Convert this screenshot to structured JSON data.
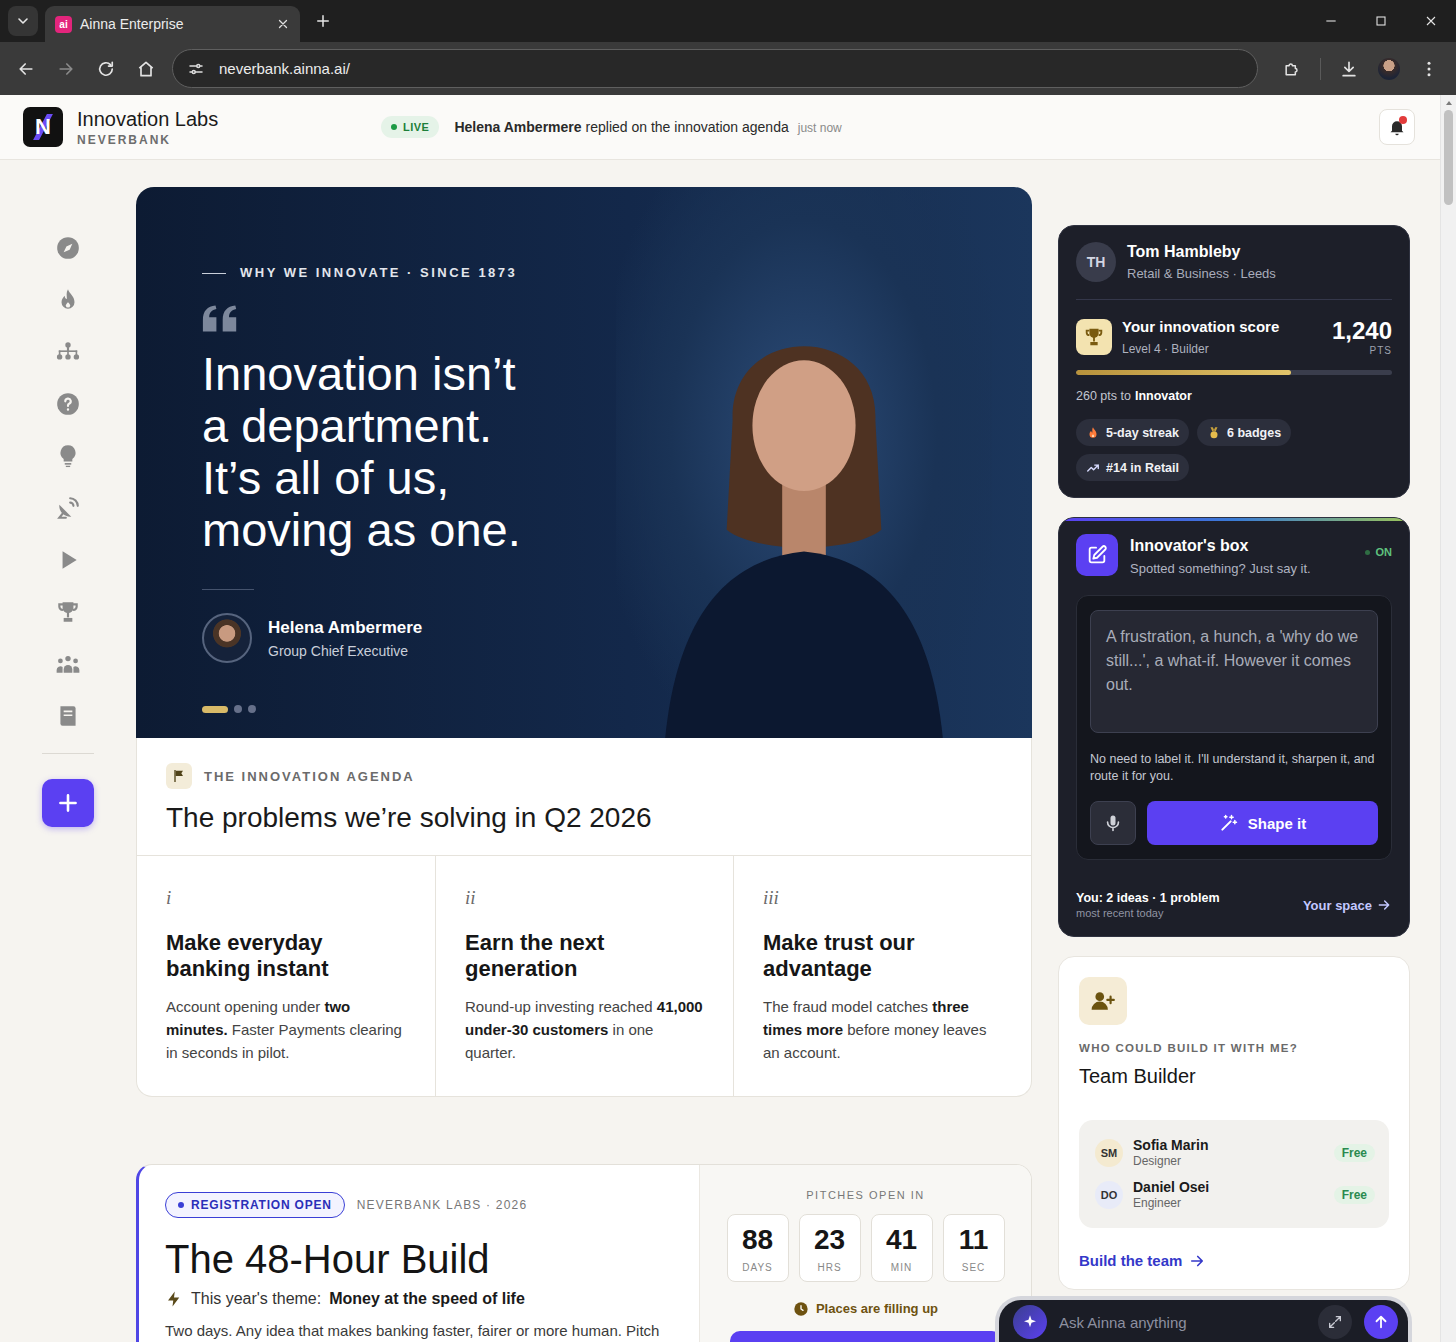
{
  "browser": {
    "tab": {
      "favicon": "ai",
      "title": "Ainna Enterprise",
      "selected": true
    },
    "navigation": {
      "back_enabled": true,
      "forward_enabled": false
    },
    "address": "neverbank.ainna.ai/"
  },
  "header": {
    "logo": "N",
    "title": "Innovation Labs",
    "subtitle": "NEVERBANK",
    "live": "LIVE",
    "activity": {
      "name": "Helena Ambermere",
      "text": "replied on the innovation agenda",
      "time": "just now"
    },
    "notifications_unread": true
  },
  "sidebar": {
    "items": [
      {
        "selected": false
      },
      {
        "selected": false
      },
      {
        "selected": false
      },
      {
        "selected": false
      },
      {
        "selected": false
      },
      {
        "selected": false
      },
      {
        "selected": false
      },
      {
        "selected": false
      },
      {
        "selected": false
      },
      {
        "selected": false
      }
    ]
  },
  "hero": {
    "eyebrow": "WHY WE INNOVATE · SINCE 1873",
    "quote": [
      "Innovation isn’t",
      "a department.",
      "It’s all of us,",
      "moving as one."
    ],
    "author": {
      "name": "Helena Ambermere",
      "role": "Group Chief Executive"
    },
    "slides": [
      {
        "selected": true
      },
      {
        "selected": false
      },
      {
        "selected": false
      }
    ]
  },
  "agenda": {
    "eyebrow": "THE INNOVATION AGENDA",
    "title": "The problems we’re solving in Q2 2026",
    "items": [
      {
        "numeral": "i",
        "title_lines": [
          "Make everyday",
          "banking instant"
        ],
        "body": [
          {
            "text": "Account opening under ",
            "bold": false
          },
          {
            "text": "two minutes.",
            "bold": true
          },
          {
            "text": " Faster Payments clearing in seconds in pilot.",
            "bold": false
          }
        ]
      },
      {
        "numeral": "ii",
        "title_lines": [
          "Earn the next",
          "generation"
        ],
        "body": [
          {
            "text": "Round-up investing reached ",
            "bold": false
          },
          {
            "text": "41,000 under-30 customers",
            "bold": true
          },
          {
            "text": " in one quarter.",
            "bold": false
          }
        ]
      },
      {
        "numeral": "iii",
        "title_lines": [
          "Make trust our",
          "advantage"
        ],
        "body": [
          {
            "text": "The fraud model catches ",
            "bold": false
          },
          {
            "text": "three times more",
            "bold": true
          },
          {
            "text": " before money leaves an account.",
            "bold": false
          }
        ]
      }
    ]
  },
  "build": {
    "badge": "REGISTRATION OPEN",
    "org": "NEVERBANK LABS · 2026",
    "title": "The 48-Hour Build",
    "theme_label": "This year's theme:",
    "theme": "Money at the speed of life",
    "description": "Two days. Any idea that makes banking faster, fairer or more human. Pitch",
    "countdown": {
      "label": "PITCHES OPEN IN",
      "units": [
        {
          "value": "88",
          "unit": "DAYS"
        },
        {
          "value": "23",
          "unit": "HRS"
        },
        {
          "value": "41",
          "unit": "MIN"
        },
        {
          "value": "11",
          "unit": "SEC"
        }
      ]
    },
    "note": "Places are filling up"
  },
  "profile": {
    "initials": "TH",
    "name": "Tom Hambleby",
    "meta": "Retail & Business · Leeds",
    "score_label": "Your innovation score",
    "level_label": "Level 4 · Builder",
    "score": "1,240",
    "score_unit": "PTS",
    "level": 0.68,
    "to_next": "260 pts to",
    "next_rank": "Innovator",
    "chips": [
      {
        "kind": "streak",
        "label": "5-day streak"
      },
      {
        "kind": "badges",
        "label": "6 badges"
      },
      {
        "kind": "rank",
        "label": "#14 in Retail"
      }
    ]
  },
  "innovators_box": {
    "title": "Innovator's box",
    "subtitle": "Spotted something? Just say it.",
    "status": "ON",
    "on": true,
    "placeholder": "A frustration, a hunch, a 'why do we still...', a what-if. However it comes out.",
    "hint": "No need to label it. I'll understand it, sharpen it, and route it for you.",
    "button": "Shape it",
    "stats": "You: 2 ideas · 1 problem",
    "stats_sub": "most recent today",
    "link": "Your space"
  },
  "team_builder": {
    "eyebrow": "WHO COULD BUILD IT WITH ME?",
    "title": "Team Builder",
    "members": [
      {
        "initials": "SM",
        "name": "Sofia Marin",
        "role": "Designer",
        "status": "Free",
        "color": "#f4ead0"
      },
      {
        "initials": "DO",
        "name": "Daniel Osei",
        "role": "Engineer",
        "status": "Free",
        "color": "#e8ebf8"
      }
    ],
    "link": "Build the team"
  },
  "assistant": {
    "placeholder": "Ask Ainna anything"
  }
}
